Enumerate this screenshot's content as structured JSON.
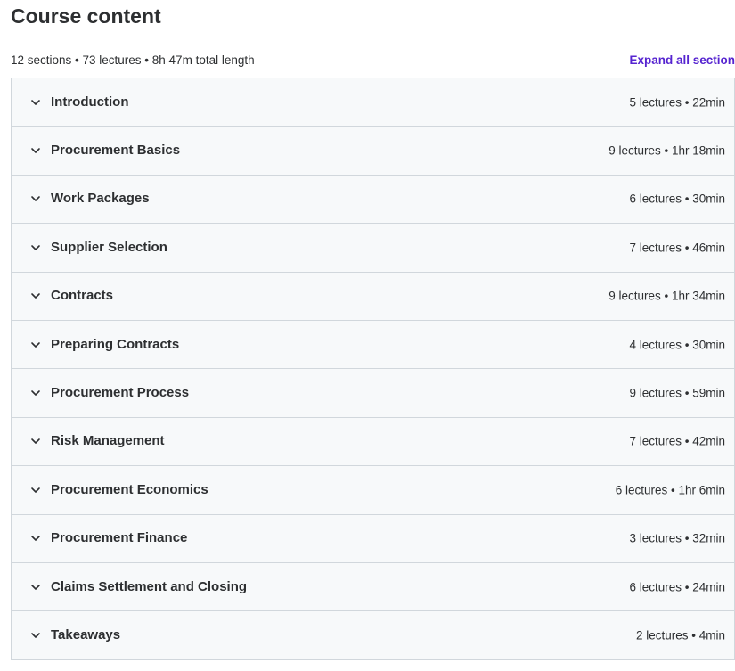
{
  "header": {
    "title": "Course content",
    "summary": "12 sections • 73 lectures • 8h 47m total length",
    "expand_all_label": "Expand all section"
  },
  "icons": {
    "section_toggle": "chevron-down-icon"
  },
  "colors": {
    "accent_link": "#5624d0",
    "section_background": "#f7f9fa",
    "border": "#d1d7dc",
    "text": "#2d2f31"
  },
  "sections": [
    {
      "title": "Introduction",
      "meta": "5 lectures • 22min"
    },
    {
      "title": "Procurement Basics",
      "meta": "9 lectures • 1hr 18min"
    },
    {
      "title": "Work Packages",
      "meta": "6 lectures • 30min"
    },
    {
      "title": "Supplier Selection",
      "meta": "7 lectures • 46min"
    },
    {
      "title": "Contracts",
      "meta": "9 lectures • 1hr 34min"
    },
    {
      "title": "Preparing Contracts",
      "meta": "4 lectures • 30min"
    },
    {
      "title": "Procurement Process",
      "meta": "9 lectures • 59min"
    },
    {
      "title": "Risk Management",
      "meta": "7 lectures • 42min"
    },
    {
      "title": "Procurement Economics",
      "meta": "6 lectures • 1hr 6min"
    },
    {
      "title": "Procurement Finance",
      "meta": "3 lectures • 32min"
    },
    {
      "title": "Claims Settlement and Closing",
      "meta": "6 lectures • 24min"
    },
    {
      "title": "Takeaways",
      "meta": "2 lectures • 4min"
    }
  ]
}
